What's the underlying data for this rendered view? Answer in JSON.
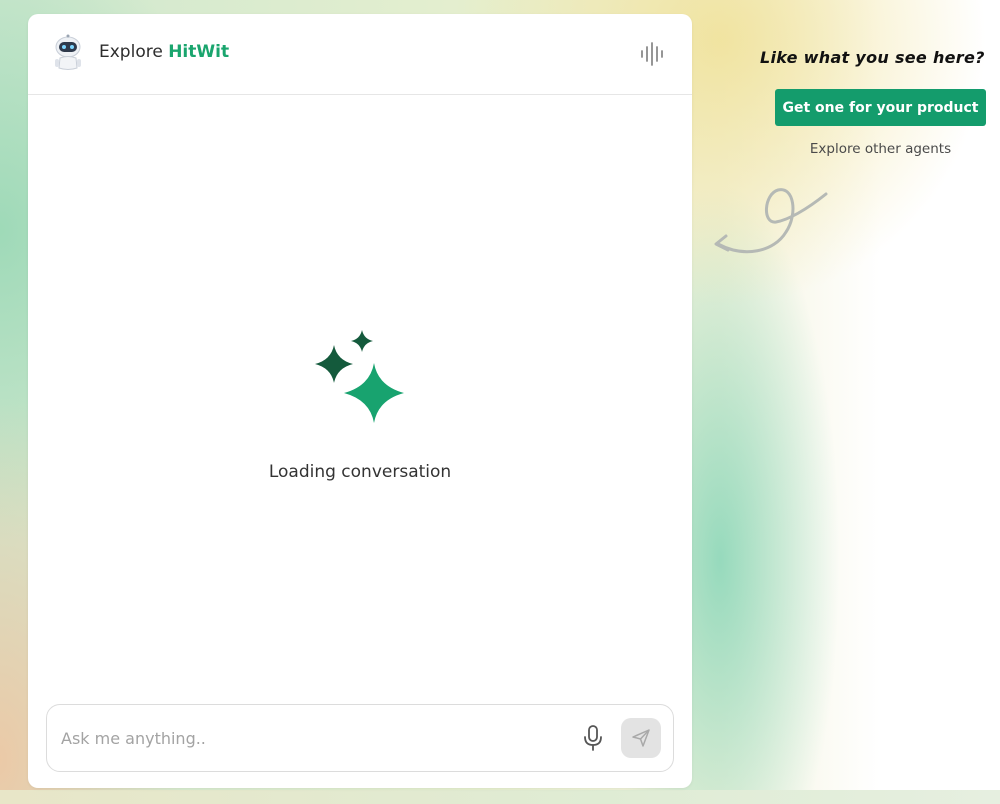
{
  "header": {
    "title_prefix": "Explore",
    "title_brand": "HitWit",
    "avatar_icon": "robot-avatar-icon",
    "voice_icon": "sound-wave-icon"
  },
  "main": {
    "loading_icon": "sparkles-icon",
    "loading_text": "Loading conversation"
  },
  "composer": {
    "placeholder": "Ask me anything..",
    "mic_icon": "microphone-icon",
    "send_icon": "send-icon"
  },
  "promo": {
    "heading": "Like what you see here?",
    "cta_label": "Get one for your product",
    "link_label": "Explore other agents",
    "arrow_icon": "curly-arrow-icon"
  },
  "colors": {
    "brand_green": "#1aa56e",
    "cta_green": "#149c6c",
    "sparkle_dark": "#145a3c",
    "sparkle_light": "#18a36f"
  }
}
